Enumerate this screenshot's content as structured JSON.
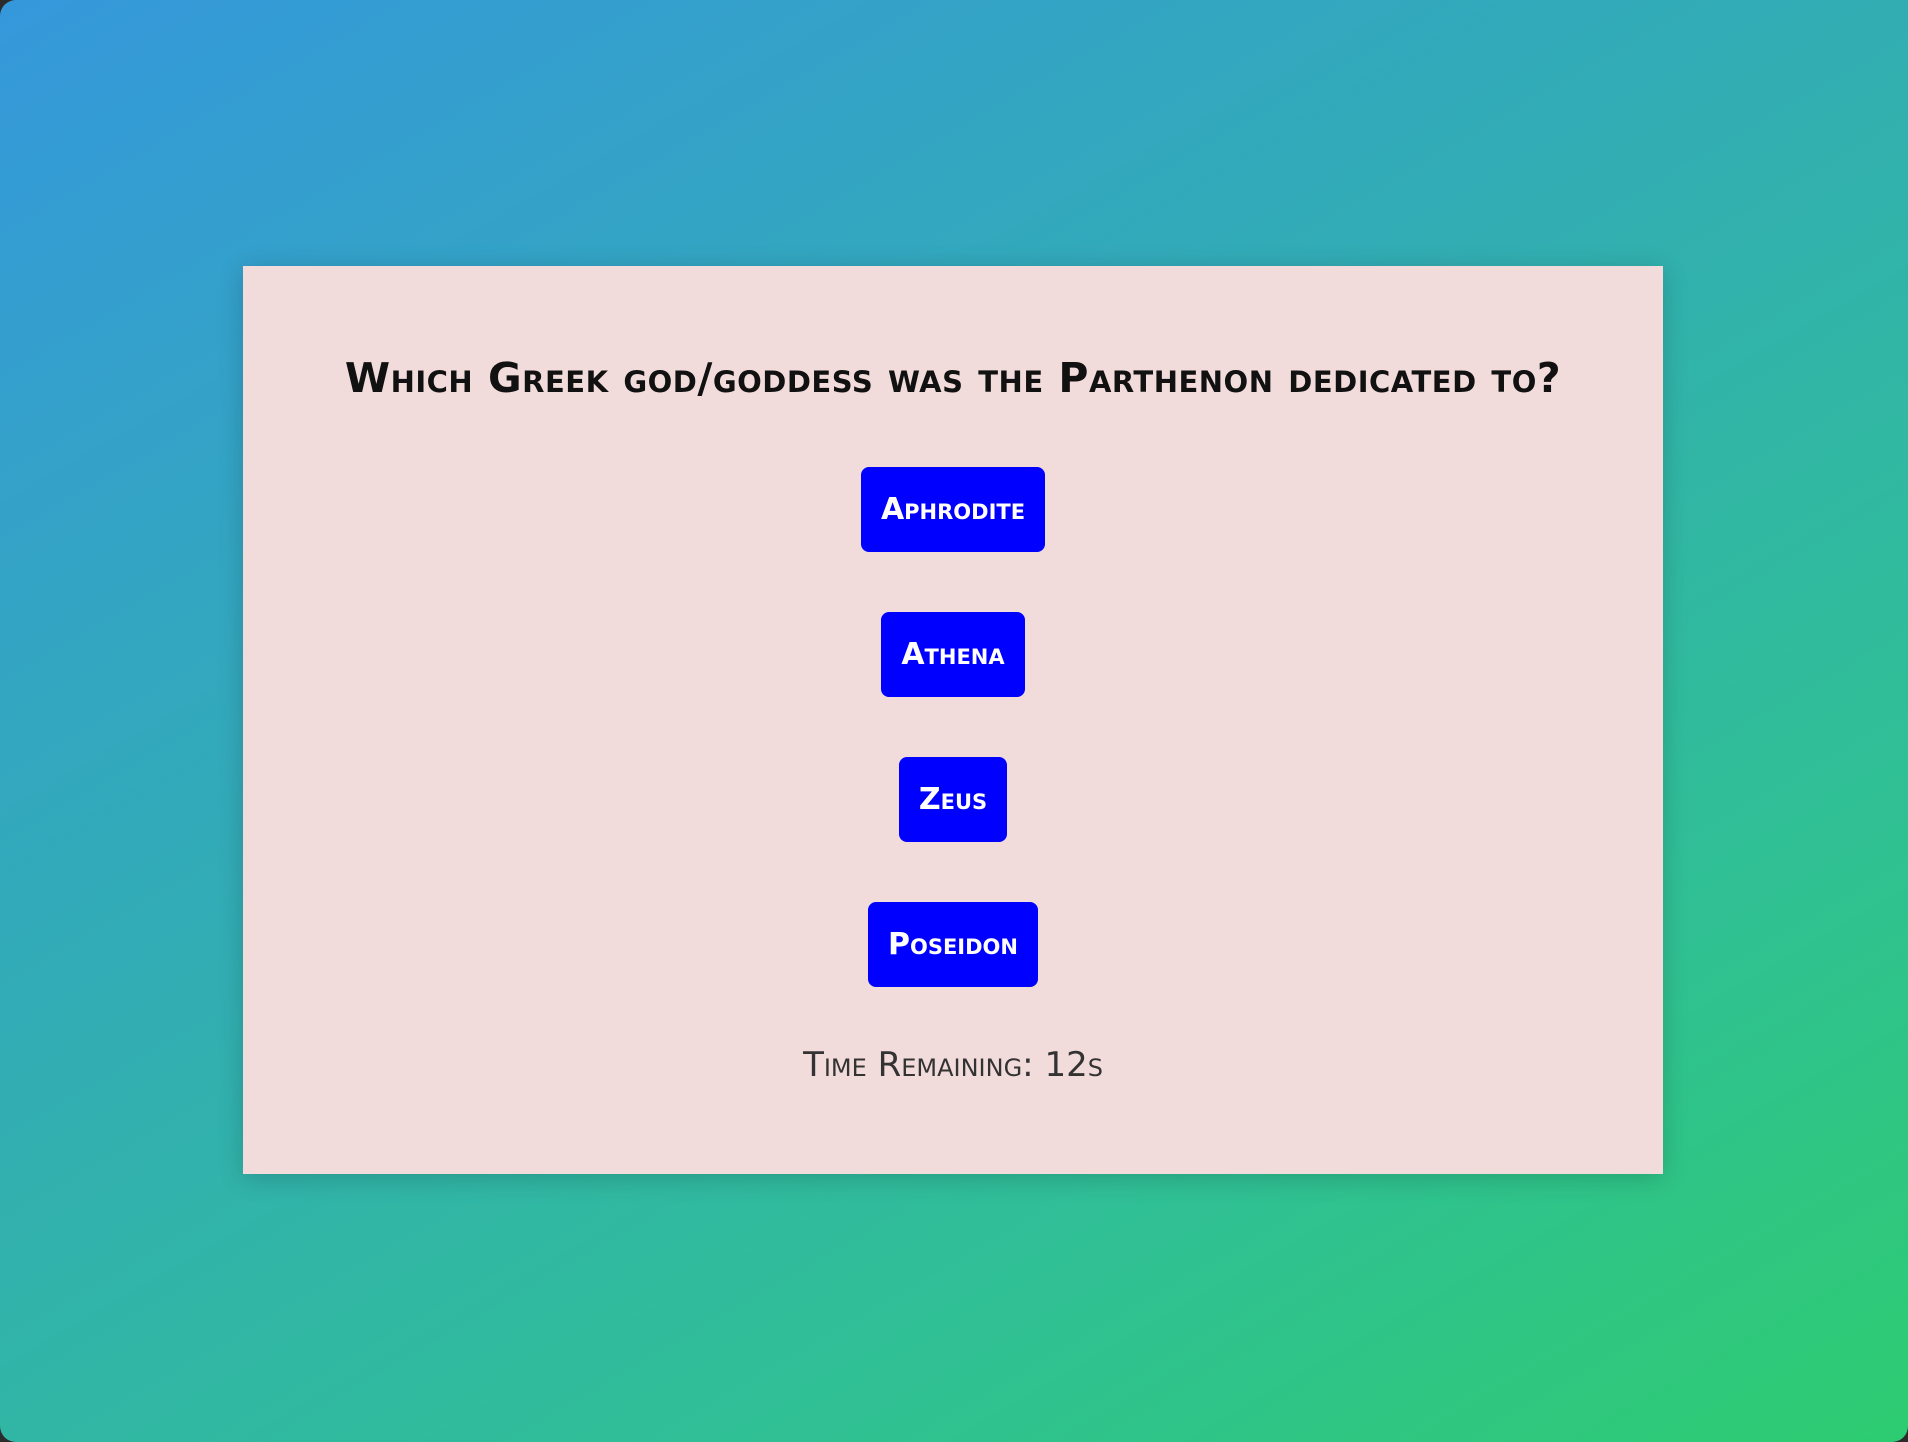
{
  "quiz": {
    "question": "Which Greek god/goddess was the Parthenon dedicated to?",
    "answers": [
      {
        "label": "Aphrodite"
      },
      {
        "label": "Athena"
      },
      {
        "label": "Zeus"
      },
      {
        "label": "Poseidon"
      }
    ],
    "timer": {
      "label": "Time Remaining:",
      "value": "12s"
    }
  },
  "colors": {
    "background_gradient_start": "#3598db",
    "background_gradient_end": "#2ecc71",
    "card_background": "#f2dcdb",
    "button_background": "#0000ff",
    "button_text": "#ffffff",
    "question_text": "#111111",
    "timer_text": "#333333"
  }
}
